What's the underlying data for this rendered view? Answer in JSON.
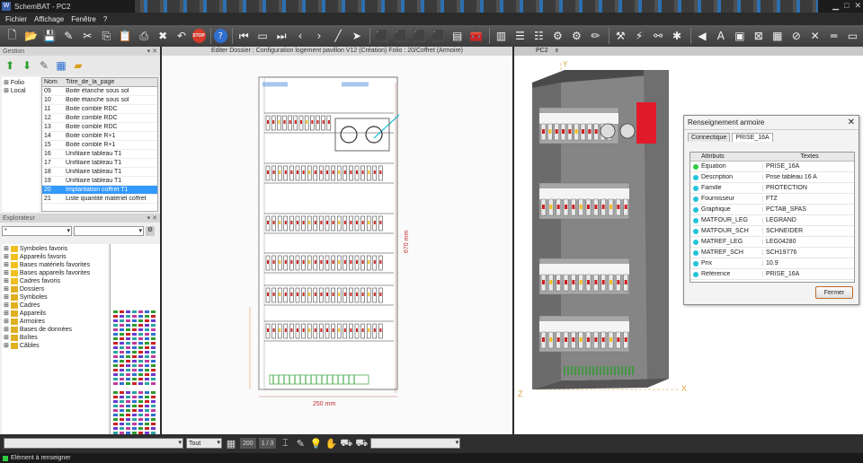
{
  "app": {
    "title": "SchemBAT - PC2",
    "logo": "W"
  },
  "menu": [
    "Fichier",
    "Affichage",
    "Fenêtre",
    "?"
  ],
  "toolbar": {
    "stop_label": "STOP",
    "help_label": "?"
  },
  "gestion": {
    "title": "Gestion",
    "tree": [
      "Folio",
      "Local"
    ],
    "columns": [
      "Nom",
      "Titre_de_la_page"
    ],
    "rows": [
      {
        "nom": "09",
        "titre": "Boite étanche sous sol"
      },
      {
        "nom": "10",
        "titre": "Boite étanche sous sol"
      },
      {
        "nom": "11",
        "titre": "Boite comble RDC"
      },
      {
        "nom": "12",
        "titre": "Boite comble RDC"
      },
      {
        "nom": "13",
        "titre": "Boite comble RDC"
      },
      {
        "nom": "14",
        "titre": "Boite comble R+1"
      },
      {
        "nom": "15",
        "titre": "Boite comble R+1"
      },
      {
        "nom": "16",
        "titre": "Unifilaire tableau T1"
      },
      {
        "nom": "17",
        "titre": "Unifilaire tableau T1"
      },
      {
        "nom": "18",
        "titre": "Unifilaire tableau T1"
      },
      {
        "nom": "19",
        "titre": "Unifilaire tableau T1"
      },
      {
        "nom": "20",
        "titre": "Implantation coffret T1",
        "selected": true
      },
      {
        "nom": "21",
        "titre": "Liste quantité matériel coffret"
      }
    ]
  },
  "explorer": {
    "title": "Explorateur",
    "combo1": "*",
    "combo2": "",
    "items": [
      "Symboles favoris",
      "Appareils favoris",
      "Bases matériels favorites",
      "Bases appareils favorites",
      "Cadres favoris",
      "Dossiers",
      "Symboles",
      "Cadres",
      "Appareils",
      "Armoires",
      "Bases de données",
      "Boîtes",
      "Câbles"
    ]
  },
  "editor": {
    "tab": "Editer Dossier : Configuration logement pavillon V12 (Création)  Folio : 20/Coffret (Armoire)",
    "dim_width": "250 mm",
    "dim_height": "670 mm"
  },
  "view3d": {
    "tab": "PC2",
    "tab_close": "x",
    "axis_x": "X",
    "axis_y": "Y",
    "axis_z": "Z"
  },
  "dialog": {
    "title": "Renseignement armoire",
    "tabs": [
      "Connectique",
      "PRISE_16A"
    ],
    "columns": [
      "Attributs",
      "Textes"
    ],
    "rows": [
      {
        "k": "Equation",
        "v": "PRISE_16A",
        "c": "#2ecc40"
      },
      {
        "k": "Description",
        "v": "Prise tableau 16 A",
        "c": "#22c3d9"
      },
      {
        "k": "Famille",
        "v": "PROTECTION",
        "c": "#22c3d9"
      },
      {
        "k": "Fournisseur",
        "v": "FTZ",
        "c": "#22c3d9"
      },
      {
        "k": "Graphique",
        "v": "PCTAB_SPAS",
        "c": "#22c3d9"
      },
      {
        "k": "MATFOUR_LEG",
        "v": "LEGRAND",
        "c": "#22c3d9"
      },
      {
        "k": "MATFOUR_SCH",
        "v": "SCHNEIDER",
        "c": "#22c3d9"
      },
      {
        "k": "MATREF_LEG",
        "v": "LEG04280",
        "c": "#22c3d9"
      },
      {
        "k": "MATREF_SCH",
        "v": "SCH19776",
        "c": "#22c3d9"
      },
      {
        "k": "Prix",
        "v": "10.9",
        "c": "#22c3d9"
      },
      {
        "k": "Référence",
        "v": "PRISE_16A",
        "c": "#22c3d9"
      }
    ],
    "close_label": "Fermer"
  },
  "statusbar": {
    "filter": "Tout",
    "zoom": "200",
    "page": "1 / 3"
  },
  "message": "Elément à renseigner"
}
